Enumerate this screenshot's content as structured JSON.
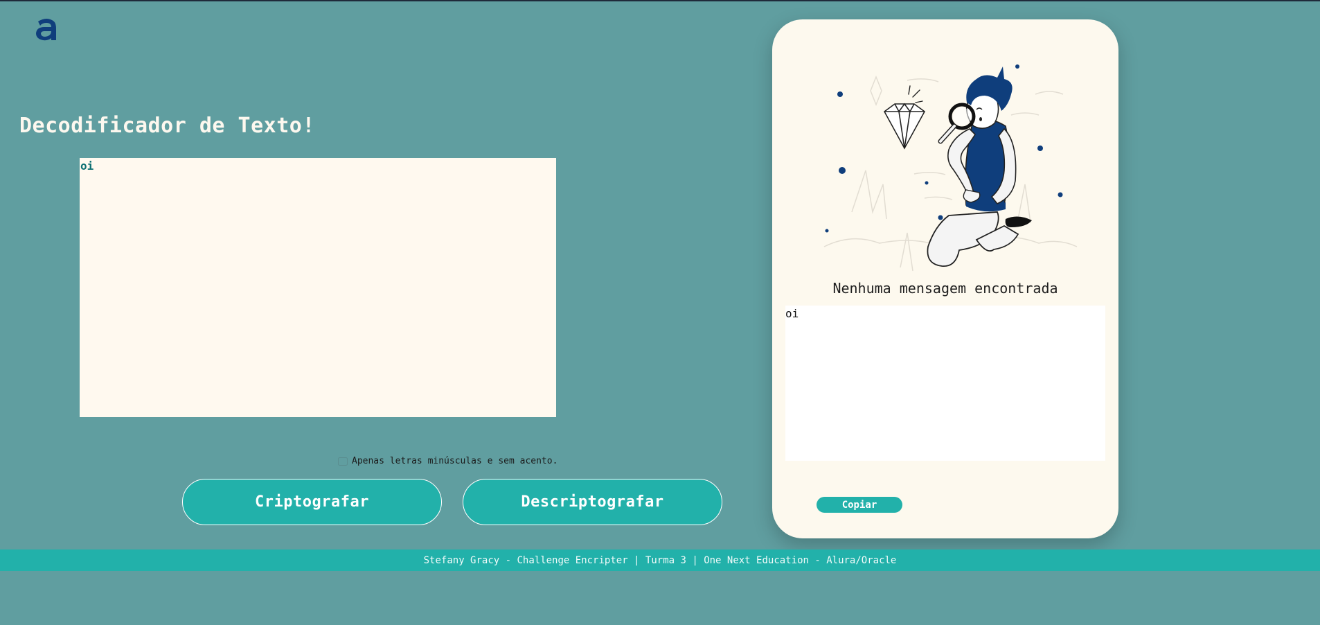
{
  "colors": {
    "page_background": "#609ea0",
    "accent": "#22b1aa",
    "input_background": "#fff9ef",
    "panel_background": "#fdf9ee",
    "brand_dark_blue": "#0f3e7c"
  },
  "header": {
    "logo_icon": "alura-logo-icon"
  },
  "main": {
    "title": "Decodificador de Texto!",
    "input_value": "oi",
    "hint_icon": "info-icon",
    "hint_text": "Apenas letras minúsculas e sem acento.",
    "encrypt_label": "Criptografar",
    "decrypt_label": "Descriptografar"
  },
  "panel": {
    "illustration_icon": "person-with-magnifying-glass-illustration",
    "title": "Nenhuma mensagem encontrada",
    "output_value": "oi",
    "copy_label": "Copiar"
  },
  "footer": {
    "text": "Stefany Gracy - Challenge Encripter | Turma 3 | One Next Education - Alura/Oracle"
  }
}
